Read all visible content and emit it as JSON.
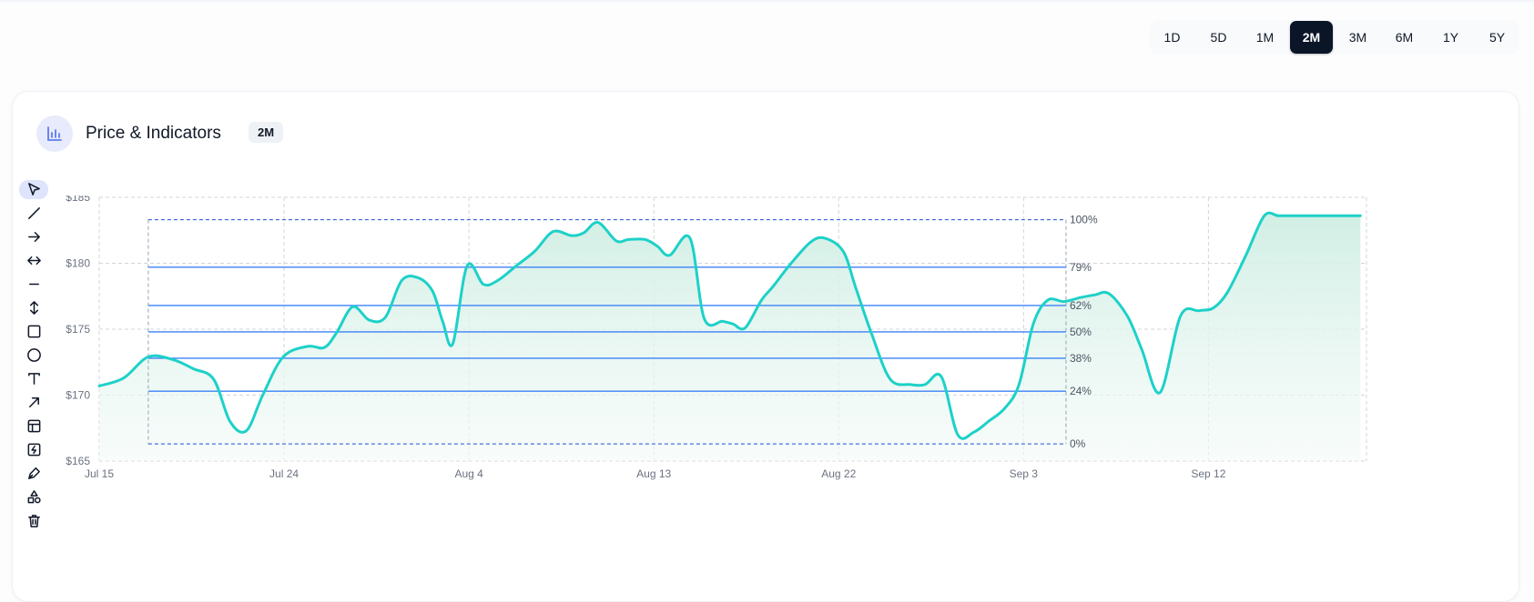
{
  "range_selector": {
    "buttons": [
      "1D",
      "5D",
      "1M",
      "2M",
      "3M",
      "6M",
      "1Y",
      "5Y"
    ],
    "active": "2M"
  },
  "card": {
    "title": "Price & Indicators",
    "badge": "2M",
    "icon": "bar-chart-icon"
  },
  "toolbar": {
    "tools": [
      {
        "name": "select-tool",
        "icon": "cursor-icon",
        "active": true
      },
      {
        "name": "trend-line-tool",
        "icon": "line-icon",
        "active": false
      },
      {
        "name": "ray-tool",
        "icon": "arrow-right-icon",
        "active": false
      },
      {
        "name": "extended-line-tool",
        "icon": "arrow-left-right-icon",
        "active": false
      },
      {
        "name": "horizontal-line-tool",
        "icon": "horizontal-line-icon",
        "active": false
      },
      {
        "name": "vertical-line-tool",
        "icon": "arrow-up-down-icon",
        "active": false
      },
      {
        "name": "rectangle-tool",
        "icon": "square-icon",
        "active": false
      },
      {
        "name": "circle-tool",
        "icon": "circle-icon",
        "active": false
      },
      {
        "name": "text-tool",
        "icon": "text-icon",
        "active": false
      },
      {
        "name": "arrow-tool",
        "icon": "arrow-up-right-icon",
        "active": false
      },
      {
        "name": "layout-tool",
        "icon": "layout-icon",
        "active": false
      },
      {
        "name": "indicator-tool",
        "icon": "activity-box-icon",
        "active": false
      },
      {
        "name": "pen-tool",
        "icon": "pen-icon",
        "active": false
      },
      {
        "name": "shapes-tool",
        "icon": "shapes-icon",
        "active": false
      },
      {
        "name": "delete-tool",
        "icon": "trash-icon",
        "active": false
      }
    ]
  },
  "colors": {
    "line": "#1dd1c8",
    "area": "#d9f3ea",
    "fib_line": "#3b82f6",
    "fib_box": "#1d4ed8",
    "grid": "#d1d5db",
    "active_button": "#0b1528"
  },
  "chart_data": {
    "type": "area",
    "x_ticks": [
      "Jul 15",
      "Jul 24",
      "Aug 4",
      "Aug 13",
      "Aug 22",
      "Sep 3",
      "Sep 12"
    ],
    "y_ticks": [
      "$185",
      "$180",
      "$175",
      "$170",
      "$165"
    ],
    "ylim": [
      165,
      185
    ],
    "xlim": [
      0,
      62
    ],
    "grid": true,
    "series": [
      {
        "x": [
          0,
          1.2,
          2.4,
          3.6,
          4.6,
          5.6,
          6.4,
          7.2,
          8.0,
          9.0,
          10.2,
          11.0,
          11.6,
          12.4,
          13.2,
          14.0,
          14.8,
          15.6,
          16.3,
          16.8,
          17.3,
          18.0,
          18.8,
          19.5,
          20.4,
          21.3,
          22.2,
          23.1,
          23.7,
          24.4,
          25.3,
          25.9,
          26.7,
          27.3,
          27.9,
          28.9,
          29.6,
          30.5,
          31.0,
          31.6,
          32.4,
          33.0,
          33.8,
          34.8,
          35.5,
          36.4,
          37.0,
          37.8,
          38.7,
          39.7,
          40.4,
          41.2,
          42.0,
          42.8,
          43.5,
          44.3,
          45.0,
          45.7,
          46.4,
          47.2,
          48.0,
          48.7,
          49.4,
          50.3,
          51.0,
          51.9,
          52.9,
          53.8,
          54.5,
          55.2,
          56.1,
          57.0,
          57.7,
          58.5,
          59.1,
          59.8,
          60.4,
          61.0,
          61.7
        ],
        "y": [
          170.7,
          171.3,
          172.9,
          172.7,
          172.0,
          171.2,
          168.0,
          167.3,
          170.0,
          172.9,
          173.7,
          173.6,
          174.7,
          176.7,
          175.7,
          175.9,
          178.7,
          178.9,
          177.9,
          175.6,
          173.9,
          179.8,
          178.4,
          178.7,
          179.8,
          180.9,
          182.4,
          182.1,
          182.3,
          183.1,
          181.7,
          181.8,
          181.8,
          181.3,
          180.6,
          181.9,
          175.8,
          175.6,
          175.4,
          175.1,
          177.2,
          178.3,
          179.9,
          181.6,
          181.9,
          180.9,
          178.2,
          174.6,
          171.2,
          170.8,
          170.8,
          171.4,
          167.0,
          167.2,
          168.0,
          169.0,
          170.8,
          175.4,
          177.2,
          177.1,
          177.4,
          177.6,
          177.7,
          176.0,
          173.5,
          170.2,
          176.0,
          176.4,
          176.6,
          177.8,
          180.6,
          183.6,
          183.6,
          183.6,
          183.6,
          183.6,
          183.6,
          183.6,
          183.6
        ]
      }
    ],
    "fibonacci": {
      "x_start": 2.4,
      "x_end": 47.3,
      "y_high": 183.3,
      "y_low": 166.3,
      "levels": [
        {
          "label": "100%",
          "value": 183.3
        },
        {
          "label": "79%",
          "value": 179.7
        },
        {
          "label": "62%",
          "value": 176.8
        },
        {
          "label": "50%",
          "value": 174.8
        },
        {
          "label": "38%",
          "value": 172.8
        },
        {
          "label": "24%",
          "value": 170.3
        },
        {
          "label": "0%",
          "value": 166.3
        }
      ]
    }
  }
}
